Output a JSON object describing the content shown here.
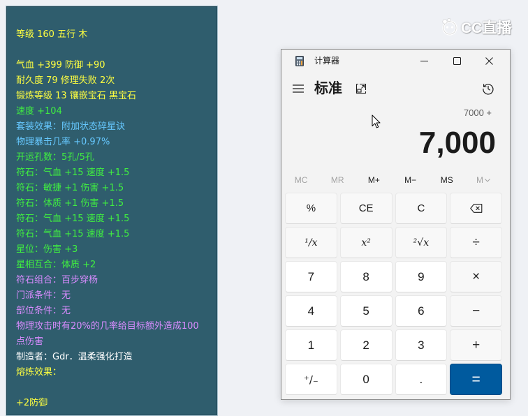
{
  "tooltip": {
    "lines": [
      {
        "text": "等级 160 五行 木",
        "color": "#ffff40"
      },
      {
        "text": "气血 +399 防御 +90",
        "color": "#ffff40"
      },
      {
        "text": "耐久度 79 修理失败 2次",
        "color": "#ffff40"
      },
      {
        "text": "锻炼等级 13 镶嵌宝石 黑宝石",
        "color": "#ffff40"
      },
      {
        "text": "速度 +104",
        "color": "#40f040"
      },
      {
        "text": "套装效果：附加状态碎星诀",
        "color": "#66c8ff"
      },
      {
        "text": "物理暴击几率 +0.97%",
        "color": "#66c8ff"
      },
      {
        "text": "开运孔数：5孔/5孔",
        "color": "#40f040"
      },
      {
        "text": "符石：气血 +15 速度 +1.5",
        "color": "#40f040"
      },
      {
        "text": "符石：敏捷 +1 伤害 +1.5",
        "color": "#40f040"
      },
      {
        "text": "符石：体质 +1 伤害 +1.5",
        "color": "#40f040"
      },
      {
        "text": "符石：气血 +15 速度 +1.5",
        "color": "#40f040"
      },
      {
        "text": "符石：气血 +15 速度 +1.5",
        "color": "#40f040"
      },
      {
        "text": "星位：伤害 +3",
        "color": "#40f040"
      },
      {
        "text": "星相互合：体质 +2",
        "color": "#40f040"
      },
      {
        "text": "符石组合：百步穿杨",
        "color": "#d98cff"
      },
      {
        "text": "门派条件：无",
        "color": "#d98cff"
      },
      {
        "text": "部位条件：无",
        "color": "#d98cff"
      },
      {
        "text": "物理攻击时有20%的几率给目标额外造成100",
        "color": "#d98cff"
      },
      {
        "text": "点伤害",
        "color": "#d98cff"
      },
      {
        "text": "制造者：Gdr．温柔强化打造",
        "color": "#ffffff"
      },
      {
        "text": "熔炼效果：",
        "color": "#ffff40"
      },
      {
        "text": "+2防御",
        "color": "#ffff40"
      }
    ]
  },
  "watermark": {
    "text": "CC直播"
  },
  "calculator": {
    "title": "计算器",
    "mode": "标准",
    "expression": "7000 +",
    "display": "7,000",
    "memory": [
      {
        "label": "MC",
        "enabled": false
      },
      {
        "label": "MR",
        "enabled": false
      },
      {
        "label": "M+",
        "enabled": true
      },
      {
        "label": "M−",
        "enabled": true
      },
      {
        "label": "MS",
        "enabled": true
      },
      {
        "label": "M",
        "enabled": false
      }
    ],
    "keys": {
      "percent": "%",
      "clear_entry": "CE",
      "clear": "C",
      "reciprocal": "¹/x",
      "square": "x²",
      "square_root": "²√x",
      "divide": "÷",
      "seven": "7",
      "eight": "8",
      "nine": "9",
      "multiply": "×",
      "four": "4",
      "five": "5",
      "six": "6",
      "subtract": "−",
      "one": "1",
      "two": "2",
      "three": "3",
      "add": "+",
      "negate": "⁺/₋",
      "zero": "0",
      "decimal": ".",
      "equals": "="
    }
  },
  "icons": {
    "app": "calculator-app-icon",
    "menu": "hamburger-menu-icon",
    "keep_on_top": "keep-on-top-icon",
    "history": "history-icon",
    "minimize": "minimize-icon",
    "maximize": "maximize-icon",
    "close": "close-icon",
    "backspace": "backspace-icon",
    "memory_list": "chevron-down-icon",
    "cursor": "mouse-cursor-icon",
    "watermark_logo": "cc-logo-icon"
  },
  "colors": {
    "page_bg": "#eff1f5",
    "tooltip_bg": "#2f5d6d",
    "tooltip_border": "#a9c3cf",
    "window_bg": "#f3f3f3",
    "accent": "#005a9e",
    "disabled": "#a3a3a3"
  }
}
